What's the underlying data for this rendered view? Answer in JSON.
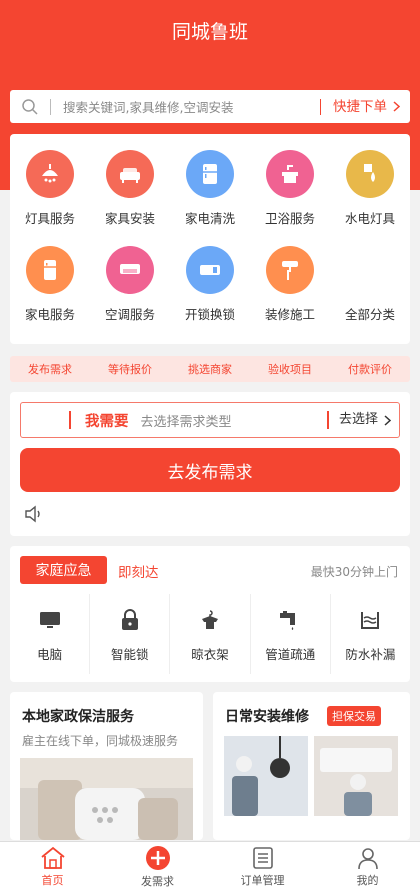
{
  "header": {
    "title": "同城鲁班"
  },
  "search": {
    "placeholder": "搜索关键词,家具维修,空调安装",
    "quick_label": "快捷下单"
  },
  "services": [
    {
      "label": "灯具服务",
      "icon": "lamp-icon",
      "color": "#f56a57"
    },
    {
      "label": "家具安装",
      "icon": "sofa-icon",
      "color": "#f56a57"
    },
    {
      "label": "家电清洗",
      "icon": "fridge-icon",
      "color": "#6ba8f7"
    },
    {
      "label": "卫浴服务",
      "icon": "sink-icon",
      "color": "#f06292"
    },
    {
      "label": "水电灯具",
      "icon": "waterdrop-icon",
      "color": "#e8b84a"
    },
    {
      "label": "家电服务",
      "icon": "appliance-icon",
      "color": "#ff8f4f"
    },
    {
      "label": "空调服务",
      "icon": "air-conditioner-icon",
      "color": "#f06292"
    },
    {
      "label": "开锁换锁",
      "icon": "door-lock-icon",
      "color": "#6ba8f7"
    },
    {
      "label": "装修施工",
      "icon": "paint-roller-icon",
      "color": "#ff8f4f"
    },
    {
      "label": "全部分类",
      "icon": "",
      "color": ""
    }
  ],
  "steps": [
    "发布需求",
    "等待报价",
    "挑选商家",
    "验收项目",
    "付款评价"
  ],
  "need": {
    "label": "我需要",
    "hint": "去选择需求类型",
    "choose_label": "去选择",
    "publish_label": "去发布需求"
  },
  "emergency": {
    "tag": "家庭应急",
    "tagline": "即刻达",
    "fast": "最快30分钟上门",
    "items": [
      {
        "label": "电脑",
        "icon": "computer-icon"
      },
      {
        "label": "智能锁",
        "icon": "lock-icon"
      },
      {
        "label": "晾衣架",
        "icon": "clothes-rack-icon"
      },
      {
        "label": "管道疏通",
        "icon": "pipe-icon"
      },
      {
        "label": "防水补漏",
        "icon": "waterproof-icon"
      }
    ]
  },
  "promos": {
    "left": {
      "title": "本地家政保洁服务",
      "sub": "雇主在线下单，同城极速服务"
    },
    "right": {
      "title": "日常安装维修",
      "badge": "担保交易"
    }
  },
  "tabbar": [
    {
      "label": "首页",
      "icon": "home-icon",
      "active": true
    },
    {
      "label": "发需求",
      "icon": "plus-icon",
      "active": false
    },
    {
      "label": "订单管理",
      "icon": "order-list-icon",
      "active": false
    },
    {
      "label": "我的",
      "icon": "user-icon",
      "active": false
    }
  ],
  "colors": {
    "primary": "#f44531",
    "step_bg": "#fde5e1"
  }
}
